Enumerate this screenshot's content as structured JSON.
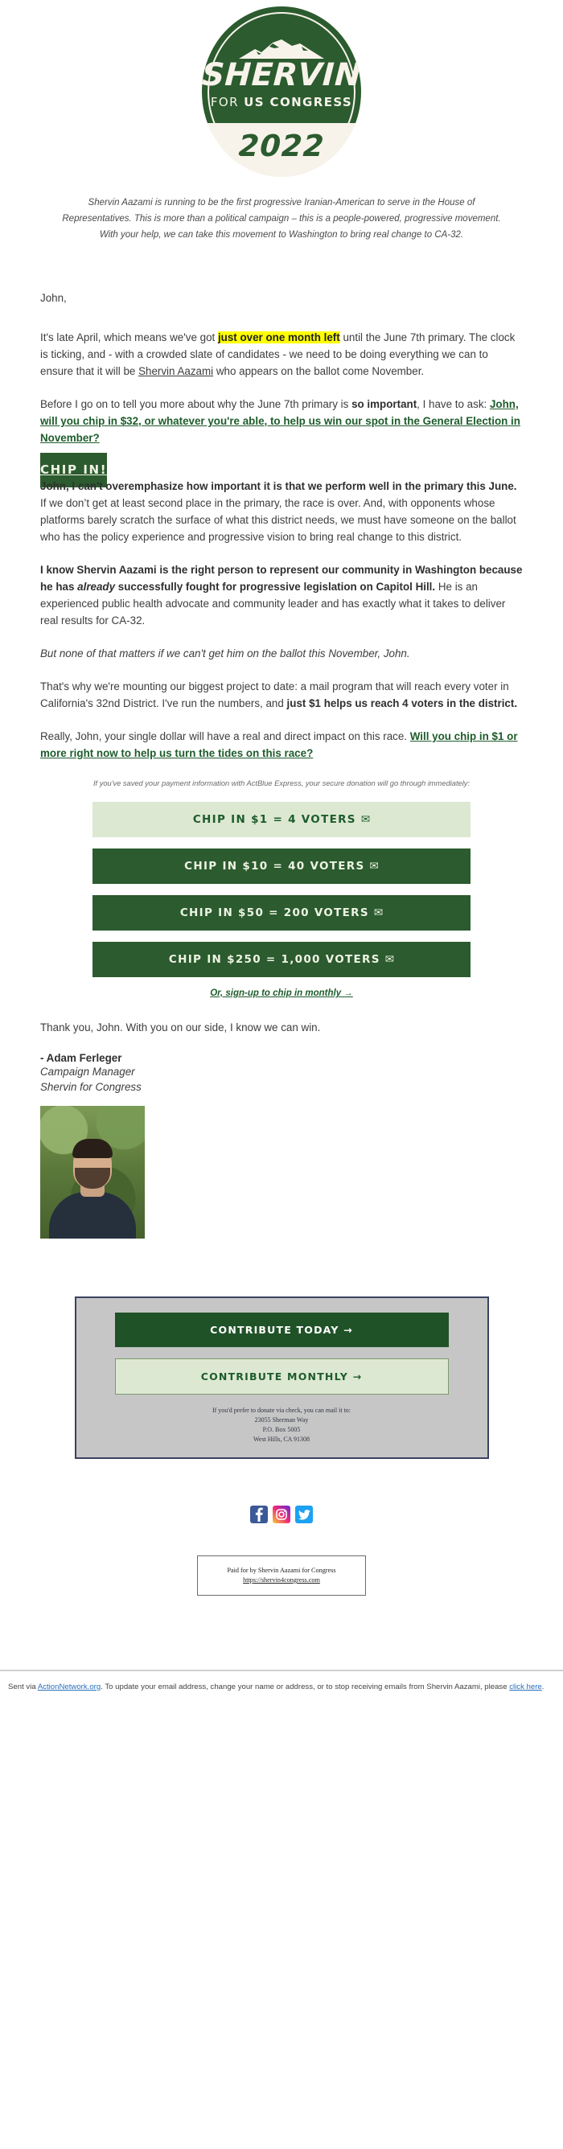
{
  "logo": {
    "name": "SHERVIN",
    "subtitle_prefix": "FOR ",
    "subtitle_bold": "US CONGRESS",
    "year": "2022",
    "green": "#2b5b2e",
    "cream": "#f7f3ea"
  },
  "intro": "Shervin Aazami is running to be the first progressive Iranian-American to serve in the House of Representatives. This is more than a political campaign – this is a people-powered, progressive movement. With your help, we can take this movement to Washington to bring real change to CA-32.",
  "body": {
    "greeting": "John,",
    "p1_a": "It's late April, which means we've got ",
    "p1_hl": "just over one month left",
    "p1_b": " until the June 7th primary. The clock is ticking, and - with a crowded slate of candidates - we need to be doing everything we can to ensure that it will be ",
    "p1_link": "Shervin Aazami",
    "p1_c": " who appears on the ballot come November.",
    "p2_a": "Before I go on to tell you more about why the June 7th primary is ",
    "p2_bold": "so important",
    "p2_b": ", I have to ask: ",
    "p2_link": "John, will you chip in $32, or whatever you're able, to help us win our spot in the General Election in November?",
    "chip_in_banner": "CHIP IN!",
    "p3_bold": "John, I can't overemphasize how important it is that we perform well in the primary this June.",
    "p3_rest": " If we don’t get at least second place in the primary, the race is over. And, with opponents whose platforms barely scratch the surface of what this district needs, we must have someone on the ballot who has the policy experience and progressive vision to bring real change to this district.",
    "p4_bold_a": "I know Shervin Aazami is the right person to represent our community in Washington because he has ",
    "p4_bold_em": "already",
    "p4_bold_b": " successfully fought for progressive legislation on Capitol Hill.",
    "p4_rest": " He is an experienced public health advocate and community leader and has exactly what it takes to deliver real results for CA-32.",
    "p5_italic": "But none of that matters if we can't get him on the ballot this November, John.",
    "p6_a": "That's why we're mounting our biggest project to date: a mail program that will reach every voter in California's 32nd District. I've run the numbers, and ",
    "p6_bold": "just $1 helps us reach 4 voters in the district.",
    "p7_a": "Really, John, your single dollar will have a real and direct impact on this race. ",
    "p7_link": "Will you chip in $1 or more right now to help us turn the tides on this race?",
    "actblue_note": "If you've saved your payment information with ActBlue Express, your secure donation will go through immediately:",
    "monthly_link": "Or, sign-up to chip in monthly →",
    "thanks": "Thank you, John. With you on our side, I know we can win.",
    "sig_name": "- Adam Ferleger",
    "sig_role1": "Campaign Manager",
    "sig_role2": "Shervin for Congress"
  },
  "donate_buttons": [
    {
      "label": "CHIP IN $1 = 4 VOTERS",
      "icon": "envelope-icon",
      "style": "light"
    },
    {
      "label": "CHIP IN $10 = 40 VOTERS",
      "icon": "envelope-icon",
      "style": "dark"
    },
    {
      "label": "CHIP IN $50 = 200 VOTERS",
      "icon": "envelope-icon",
      "style": "dark"
    },
    {
      "label": "CHIP IN $250 = 1,000 VOTERS",
      "icon": "envelope-icon",
      "style": "dark"
    }
  ],
  "footer": {
    "contribute_today": "CONTRIBUTE TODAY →",
    "contribute_monthly": "CONTRIBUTE MONTHLY →",
    "check_line1": "If you'd prefer to donate via check, you can mail it to:",
    "check_line2": "23055 Sherman Way",
    "check_line3": "P.O. Box 5005",
    "check_line4": "West Hills, CA 91308",
    "paid_for": "Paid for by Shervin Aazami for Congress",
    "paid_url": "https://shervin4congress.com",
    "sent_a": "Sent via ",
    "sent_link1": "ActionNetwork.org",
    "sent_b": ". To update your email address, change your name or address, or to stop receiving emails from Shervin Aazami, please ",
    "sent_link2": "click here",
    "sent_c": "."
  },
  "social": [
    {
      "name": "facebook-icon"
    },
    {
      "name": "instagram-icon"
    },
    {
      "name": "twitter-icon"
    }
  ]
}
